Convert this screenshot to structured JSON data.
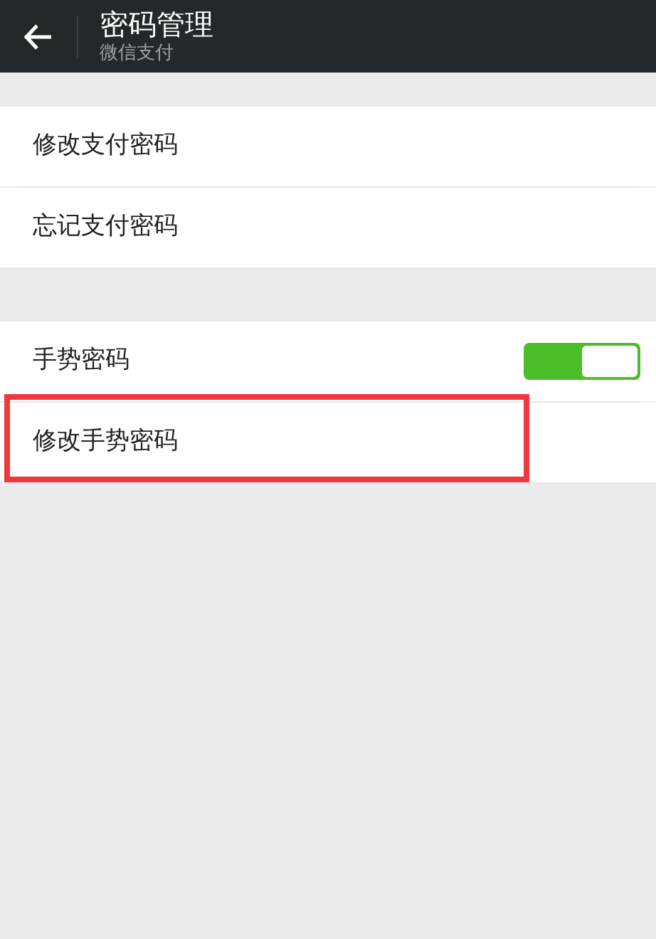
{
  "header": {
    "title": "密码管理",
    "subtitle": "微信支付"
  },
  "sections": [
    {
      "items": [
        {
          "kind": "link",
          "label": "修改支付密码",
          "highlighted": false
        },
        {
          "kind": "link",
          "label": "忘记支付密码",
          "highlighted": false
        }
      ]
    },
    {
      "items": [
        {
          "kind": "toggle",
          "label": "手势密码",
          "on": true,
          "highlighted": false
        },
        {
          "kind": "link",
          "label": "修改手势密码",
          "highlighted": true
        }
      ]
    }
  ]
}
